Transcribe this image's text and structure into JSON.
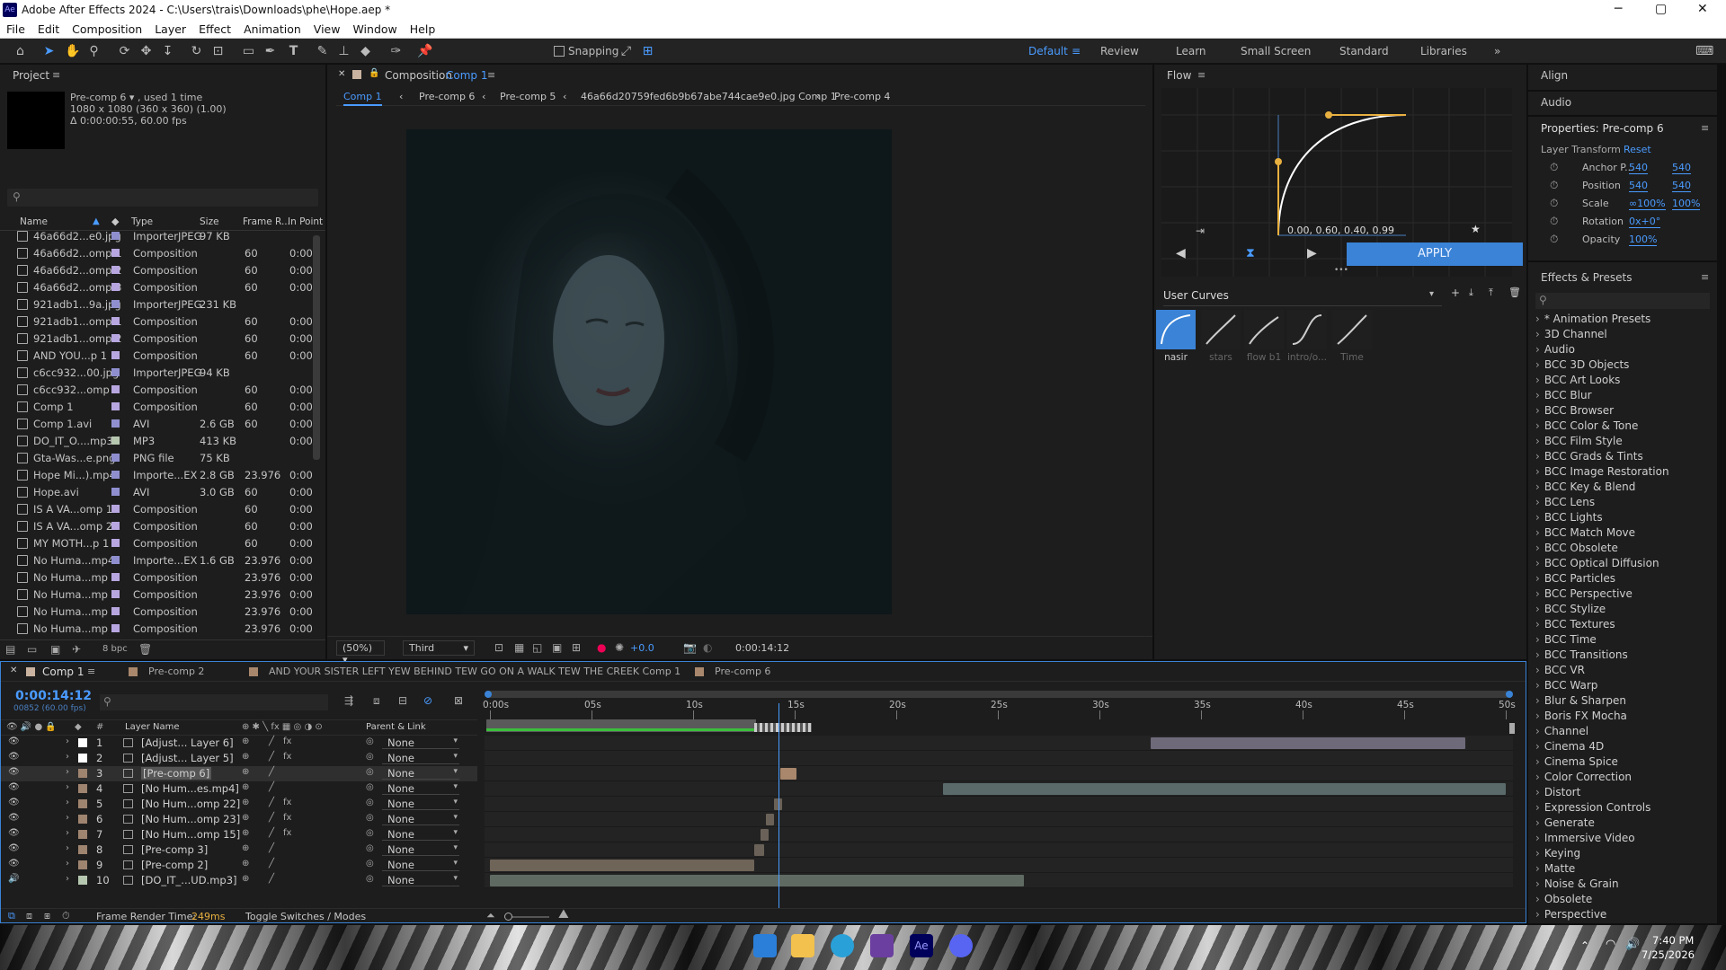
{
  "window": {
    "title": "Adobe After Effects 2024 - C:\\Users\\trais\\Downloads\\phe\\Hope.aep *",
    "minimize": "─",
    "maximize": "▢",
    "close": "✕"
  },
  "menu": [
    "File",
    "Edit",
    "Composition",
    "Layer",
    "Effect",
    "Animation",
    "View",
    "Window",
    "Help"
  ],
  "toolbar": {
    "snapping": "Snapping",
    "workspaces": [
      "Default",
      "Review",
      "Learn",
      "Small Screen",
      "Standard",
      "Libraries"
    ],
    "more": "»"
  },
  "project": {
    "title": "Project",
    "info_name": "Pre-comp 6 ▾ , used 1 time",
    "info_dims": "1080 x 1080  (360 x 360) (1.00)",
    "info_dur": "Δ 0:00:00:55, 60.00 fps",
    "search_placeholder": "",
    "columns": [
      "Name",
      "Type",
      "Size",
      "Frame R...",
      "In Point"
    ],
    "rows": [
      {
        "name": "46a66d2...e0.jpg",
        "type": "ImporterJPEG",
        "size": "97 KB",
        "fr": "",
        "in": "",
        "label": "#8f8fd0"
      },
      {
        "name": "46a66d2...omp 1",
        "type": "Composition",
        "size": "",
        "fr": "60",
        "in": "0:00",
        "label": "#b8a6e0"
      },
      {
        "name": "46a66d2...omp 2",
        "type": "Composition",
        "size": "",
        "fr": "60",
        "in": "0:00",
        "label": "#b8a6e0"
      },
      {
        "name": "46a66d2...omp 3",
        "type": "Composition",
        "size": "",
        "fr": "60",
        "in": "0:00",
        "label": "#b8a6e0"
      },
      {
        "name": "921adb1...9a.jpg",
        "type": "ImporterJPEG",
        "size": "231 KB",
        "fr": "",
        "in": "",
        "label": "#8f8fd0"
      },
      {
        "name": "921adb1...omp 1",
        "type": "Composition",
        "size": "",
        "fr": "60",
        "in": "0:00",
        "label": "#b8a6e0"
      },
      {
        "name": "921adb1...omp 2",
        "type": "Composition",
        "size": "",
        "fr": "60",
        "in": "0:00",
        "label": "#b8a6e0"
      },
      {
        "name": "AND YOU...p 1",
        "type": "Composition",
        "size": "",
        "fr": "60",
        "in": "0:00",
        "label": "#b8a6e0"
      },
      {
        "name": "c6cc932...00.jpg",
        "type": "ImporterJPEG",
        "size": "94 KB",
        "fr": "",
        "in": "",
        "label": "#8f8fd0"
      },
      {
        "name": "c6cc932...omp 1",
        "type": "Composition",
        "size": "",
        "fr": "60",
        "in": "0:00",
        "label": "#b8a6e0"
      },
      {
        "name": "Comp 1",
        "type": "Composition",
        "size": "",
        "fr": "60",
        "in": "0:00",
        "label": "#b8a6e0"
      },
      {
        "name": "Comp 1.avi",
        "type": "AVI",
        "size": "2.6 GB",
        "fr": "60",
        "in": "0:00",
        "label": "#8f8fd0"
      },
      {
        "name": "DO_IT_O....mp3",
        "type": "MP3",
        "size": "413 KB",
        "fr": "",
        "in": "0:00",
        "label": "#b6c7b0"
      },
      {
        "name": "Gta-Was...e.png",
        "type": "PNG file",
        "size": "75 KB",
        "fr": "",
        "in": "",
        "label": "#8f8fd0"
      },
      {
        "name": "Hope Mi...).mp4",
        "type": "Importe...EX",
        "size": "2.8 GB",
        "fr": "23.976",
        "in": "0:00",
        "label": "#8f8fd0"
      },
      {
        "name": "Hope.avi",
        "type": "AVI",
        "size": "3.0 GB",
        "fr": "60",
        "in": "0:00",
        "label": "#8f8fd0"
      },
      {
        "name": "IS A VA...omp 1",
        "type": "Composition",
        "size": "",
        "fr": "60",
        "in": "0:00",
        "label": "#b8a6e0"
      },
      {
        "name": "IS A VA...omp 2",
        "type": "Composition",
        "size": "",
        "fr": "60",
        "in": "0:00",
        "label": "#b8a6e0"
      },
      {
        "name": "MY MOTH...p 1",
        "type": "Composition",
        "size": "",
        "fr": "60",
        "in": "0:00",
        "label": "#b8a6e0"
      },
      {
        "name": "No Huma...mp4",
        "type": "Importe...EX",
        "size": "1.6 GB",
        "fr": "23.976",
        "in": "0:00",
        "label": "#8f8fd0"
      },
      {
        "name": "No Huma...mp 1",
        "type": "Composition",
        "size": "",
        "fr": "23.976",
        "in": "0:00",
        "label": "#b8a6e0"
      },
      {
        "name": "No Huma...mp 2",
        "type": "Composition",
        "size": "",
        "fr": "23.976",
        "in": "0:00",
        "label": "#b8a6e0"
      },
      {
        "name": "No Huma...mp 3",
        "type": "Composition",
        "size": "",
        "fr": "23.976",
        "in": "0:00",
        "label": "#b8a6e0"
      },
      {
        "name": "No Huma...mp 4",
        "type": "Composition",
        "size": "",
        "fr": "23.976",
        "in": "0:00",
        "label": "#b8a6e0"
      }
    ],
    "bpc": "8 bpc"
  },
  "composition": {
    "panel_title": "Composition",
    "comp_name": "Comp 1",
    "breadcrumbs": [
      "Comp 1",
      "Pre-comp 6",
      "Pre-comp 5",
      "46a66d20759fed6b9b67abe744cae9e0.jpg Comp 1",
      "Pre-comp 4"
    ],
    "zoom": "(50%)",
    "resolution": "Third",
    "exposure": "+0.0",
    "timecode": "0:00:14:12"
  },
  "flow": {
    "title": "Flow",
    "values": "0.00, 0.60, 0.40, 0.99",
    "apply": "APPLY",
    "user_curves": "User Curves",
    "curves": [
      "nasir",
      "stars",
      "flow b1",
      "intro/o...",
      "Time"
    ],
    "more": "•••"
  },
  "align": {
    "title": "Align"
  },
  "audio": {
    "title": "Audio"
  },
  "properties": {
    "title": "Properties: Pre-comp 6",
    "section": "Layer Transform",
    "reset": "Reset",
    "props": [
      {
        "name": "Anchor P...",
        "v1": "540",
        "v2": "540"
      },
      {
        "name": "Position",
        "v1": "540",
        "v2": "540"
      },
      {
        "name": "Scale",
        "v1": "∞100%",
        "v2": "100%"
      },
      {
        "name": "Rotation",
        "v1": "0x+0°",
        "v2": ""
      },
      {
        "name": "Opacity",
        "v1": "100%",
        "v2": ""
      }
    ]
  },
  "effects": {
    "title": "Effects & Presets",
    "items": [
      "* Animation Presets",
      "3D Channel",
      "Audio",
      "BCC 3D Objects",
      "BCC Art Looks",
      "BCC Blur",
      "BCC Browser",
      "BCC Color & Tone",
      "BCC Film Style",
      "BCC Grads & Tints",
      "BCC Image Restoration",
      "BCC Key & Blend",
      "BCC Lens",
      "BCC Lights",
      "BCC Match Move",
      "BCC Obsolete",
      "BCC Optical Diffusion",
      "BCC Particles",
      "BCC Perspective",
      "BCC Stylize",
      "BCC Textures",
      "BCC Time",
      "BCC Transitions",
      "BCC VR",
      "BCC Warp",
      "Blur & Sharpen",
      "Boris FX Mocha",
      "Channel",
      "Cinema 4D",
      "Cinema Spice",
      "Color Correction",
      "Distort",
      "Expression Controls",
      "Generate",
      "Immersive Video",
      "Keying",
      "Matte",
      "Noise & Grain",
      "Obsolete",
      "Perspective"
    ]
  },
  "timeline": {
    "tabs": [
      "Comp 1",
      "Pre-comp 2",
      "AND YOUR SISTER LEFT YEW BEHIND TEW GO ON A WALK TEW THE CREEK Comp 1",
      "Pre-comp 6"
    ],
    "timecode": "0:00:14:12",
    "frames": "00852 (60.00 fps)",
    "col_layer": "Layer Name",
    "col_parent": "Parent & Link",
    "col_hash": "#",
    "ruler": [
      "0:00s",
      "05s",
      "10s",
      "15s",
      "20s",
      "25s",
      "30s",
      "35s",
      "40s",
      "45s",
      "50s"
    ],
    "playhead_s": 14.2,
    "duration_s": 50,
    "layers": [
      {
        "num": "1",
        "name": "[Adjust... Layer 6]",
        "parent": "None",
        "label": "#ffffff",
        "fx": true,
        "bar_start": 32.5,
        "bar_end": 48.0,
        "bar_color": "#6f6a7a"
      },
      {
        "num": "2",
        "name": "[Adjust... Layer 5]",
        "parent": "None",
        "label": "#ffffff",
        "fx": true,
        "bar_start": null,
        "bar_end": null,
        "bar_color": ""
      },
      {
        "num": "3",
        "name": "[Pre-comp 6]",
        "parent": "None",
        "label": "#9f8470",
        "fx": false,
        "bar_start": 14.3,
        "bar_end": 15.1,
        "bar_color": "#a8876c"
      },
      {
        "num": "4",
        "name": "[No Hum...es.mp4]",
        "parent": "None",
        "label": "#9f8470",
        "fx": false,
        "bar_start": 22.3,
        "bar_end": 50,
        "bar_color": "#5a6a6a"
      },
      {
        "num": "5",
        "name": "[No Hum...omp 22]",
        "parent": "None",
        "label": "#9f8470",
        "fx": true,
        "bar_start": 14.0,
        "bar_end": 14.4,
        "bar_color": "#6a6258"
      },
      {
        "num": "6",
        "name": "[No Hum...omp 23]",
        "parent": "None",
        "label": "#9f8470",
        "fx": true,
        "bar_start": 13.6,
        "bar_end": 14.0,
        "bar_color": "#6a6258"
      },
      {
        "num": "7",
        "name": "[No Hum...omp 15]",
        "parent": "None",
        "label": "#9f8470",
        "fx": true,
        "bar_start": 13.3,
        "bar_end": 13.7,
        "bar_color": "#6a6258"
      },
      {
        "num": "8",
        "name": "[Pre-comp 3]",
        "parent": "None",
        "label": "#9f8470",
        "fx": false,
        "bar_start": 13.0,
        "bar_end": 13.5,
        "bar_color": "#6a6258"
      },
      {
        "num": "9",
        "name": "[Pre-comp 2]",
        "parent": "None",
        "label": "#9f8470",
        "fx": false,
        "bar_start": 0,
        "bar_end": 13.0,
        "bar_color": "#6f6458"
      },
      {
        "num": "10",
        "name": "[DO_IT_...UD.mp3]",
        "parent": "None",
        "label": "#b6c7b0",
        "fx": false,
        "bar_start": 0,
        "bar_end": 26.3,
        "bar_color": "#5f6a62"
      }
    ],
    "render_label": "Frame Render Time:",
    "render_time": "249ms",
    "toggle": "Toggle Switches / Modes"
  },
  "taskbar": {
    "time": "7:40 PM",
    "date": "7/25/2026"
  },
  "colors": {
    "accent": "#4a9bff",
    "flow_accent": "#e8b040",
    "apply": "#3a83d6"
  }
}
